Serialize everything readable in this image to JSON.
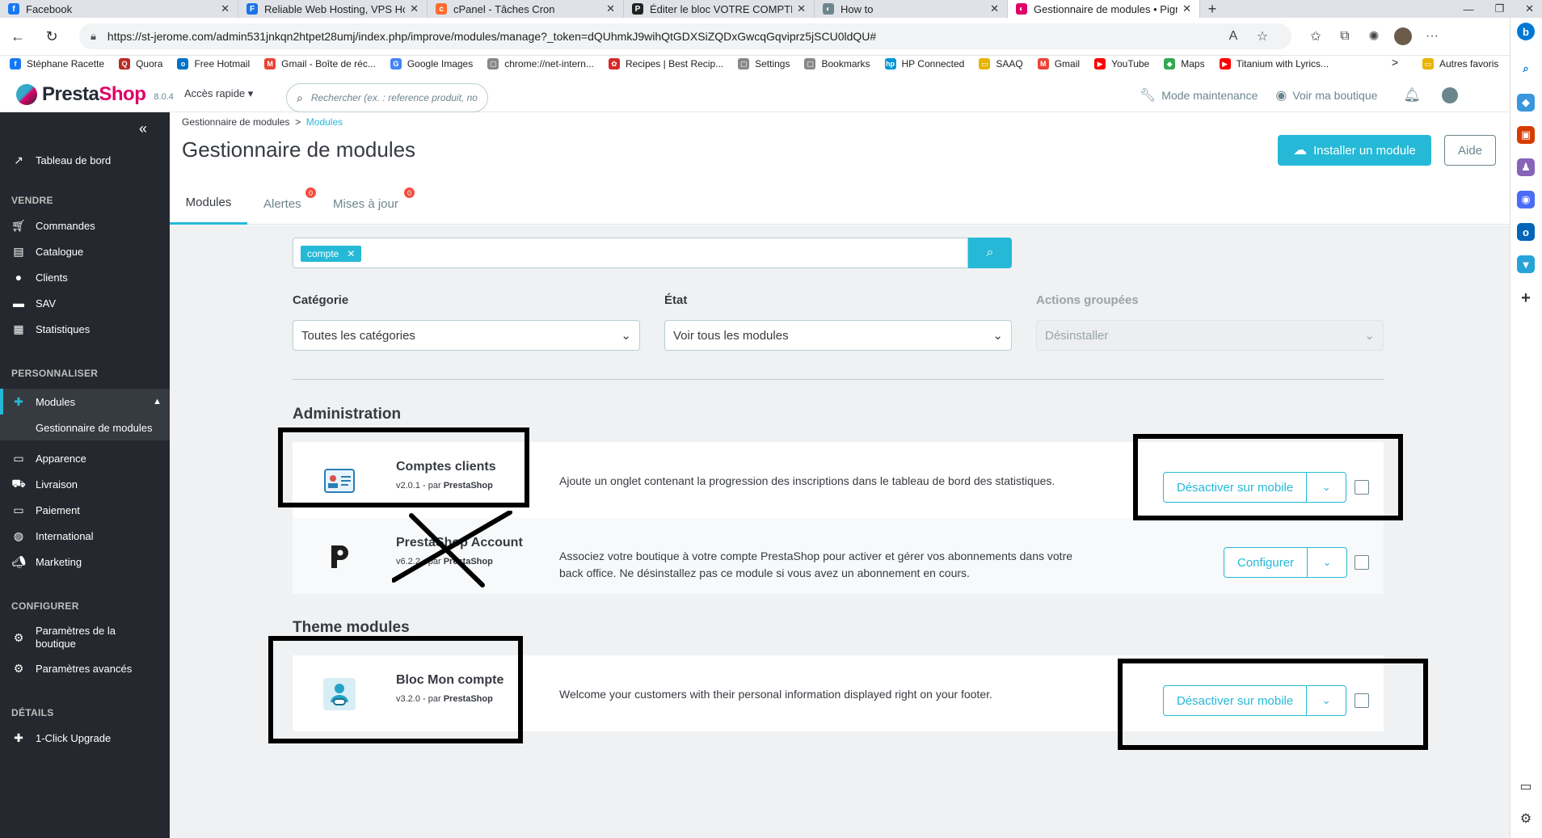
{
  "browser": {
    "tabs": [
      {
        "title": "Facebook",
        "color": "#1877f2",
        "glyph": "f"
      },
      {
        "title": "Reliable Web Hosting, VPS Hostin",
        "color": "#1a73e8",
        "glyph": "F"
      },
      {
        "title": "cPanel - Tâches Cron",
        "color": "#ff6c2c",
        "glyph": "c"
      },
      {
        "title": "Éditer le bloc VOTRE COMPTE. C",
        "color": "#222222",
        "glyph": "P"
      },
      {
        "title": "How to",
        "color": "#6c868e",
        "glyph": "◐"
      },
      {
        "title": "Gestionnaire de modules • Pignc",
        "color": "#df0067",
        "glyph": "◐"
      }
    ],
    "url": "https://st-jerome.com/admin531jnkqn2htpet28umj/index.php/improve/modules/manage?_token=dQUhmkJ9wihQtGDXSiZQDxGwcqGqviprz5jSCU0ldQU#",
    "bookmarks": [
      {
        "label": "Stéphane Racette",
        "color": "#1877f2",
        "glyph": "f"
      },
      {
        "label": "Quora",
        "color": "#b92b27",
        "glyph": "Q"
      },
      {
        "label": "Free Hotmail",
        "color": "#0072c6",
        "glyph": "o"
      },
      {
        "label": "Gmail - Boîte de réc...",
        "color": "#ea4335",
        "glyph": "M"
      },
      {
        "label": "Google Images",
        "color": "#4285f4",
        "glyph": "G"
      },
      {
        "label": "chrome://net-intern...",
        "color": "#888888",
        "glyph": "▢"
      },
      {
        "label": "Recipes | Best Recip...",
        "color": "#d62828",
        "glyph": "✿"
      },
      {
        "label": "Settings",
        "color": "#888888",
        "glyph": "▢"
      },
      {
        "label": "Bookmarks",
        "color": "#888888",
        "glyph": "▢"
      },
      {
        "label": "HP Connected",
        "color": "#0096d6",
        "glyph": "hp"
      },
      {
        "label": "SAAQ",
        "color": "#e8b400",
        "glyph": "▭"
      },
      {
        "label": "Gmail",
        "color": "#ea4335",
        "glyph": "M"
      },
      {
        "label": "YouTube",
        "color": "#ff0000",
        "glyph": "▶"
      },
      {
        "label": "Maps",
        "color": "#34a853",
        "glyph": "◆"
      },
      {
        "label": "Titanium with Lyrics...",
        "color": "#ff0000",
        "glyph": "▶"
      }
    ],
    "bookmarks_more": ">",
    "other_favorites": "Autres favoris"
  },
  "header": {
    "logo_presta": "Presta",
    "logo_shop": "Shop",
    "version": "8.0.4",
    "quick_access": "Accès rapide",
    "search_placeholder": "Rechercher (ex. : reference produit, no",
    "maintenance": "Mode maintenance",
    "view_shop": "Voir ma boutique"
  },
  "sidebar": {
    "collapse": "«",
    "dashboard": "Tableau de bord",
    "section_sell": "VENDRE",
    "sell_items": [
      "Commandes",
      "Catalogue",
      "Clients",
      "SAV",
      "Statistiques"
    ],
    "section_customize": "PERSONNALISER",
    "modules": "Modules",
    "module_manager": "Gestionnaire de modules",
    "customize_items": [
      "Apparence",
      "Livraison",
      "Paiement",
      "International",
      "Marketing"
    ],
    "section_configure": "CONFIGURER",
    "shop_params_1": "Paramètres de la",
    "shop_params_2": "boutique",
    "advanced_params": "Paramètres avancés",
    "section_details": "DÉTAILS",
    "upgrade": "1-Click Upgrade"
  },
  "page": {
    "breadcrumb_parent": "Gestionnaire de modules",
    "breadcrumb_sep": ">",
    "breadcrumb_current": "Modules",
    "title": "Gestionnaire de modules",
    "install_button": "Installer un module",
    "help_button": "Aide",
    "tabs": [
      {
        "label": "Modules"
      },
      {
        "label": "Alertes",
        "badge": "0"
      },
      {
        "label": "Mises à jour",
        "badge": "0"
      }
    ],
    "search_tag": "compte",
    "filters": {
      "category_label": "Catégorie",
      "category_value": "Toutes les catégories",
      "state_label": "État",
      "state_value": "Voir tous les modules",
      "bulk_label": "Actions groupées",
      "bulk_value": "Désinstaller"
    }
  },
  "groups": [
    {
      "title": "Administration",
      "modules": [
        {
          "name": "Comptes clients",
          "version": "v2.0.1 - par",
          "author": "PrestaShop",
          "description_1": "Ajoute un onglet contenant la progression des inscriptions dans le tableau de bord des statistiques.",
          "description_2": "",
          "action": "Désactiver sur mobile",
          "icon": "id-card-icon"
        },
        {
          "name": "PrestaShop Account",
          "version": "v6.2.2 - par",
          "author": "PrestaShop",
          "description_1": "Associez votre boutique à votre compte PrestaShop pour activer et gérer vos abonnements dans votre",
          "description_2": "back office. Ne désinstallez pas ce module si vous avez un abonnement en cours.",
          "action": "Configurer",
          "icon": "prestashop-p-icon"
        }
      ]
    },
    {
      "title": "Theme modules",
      "modules": [
        {
          "name": "Bloc Mon compte",
          "version": "v3.2.0 - par",
          "author": "PrestaShop",
          "description_1": "Welcome your customers with their personal information displayed right on your footer.",
          "description_2": "",
          "action": "Désactiver sur mobile",
          "icon": "user-link-icon"
        }
      ]
    }
  ],
  "colors": {
    "accent": "#25b9d7",
    "sidebar_bg": "#25292f",
    "brand_pink": "#df0067",
    "badge_red": "#f54c3e"
  }
}
